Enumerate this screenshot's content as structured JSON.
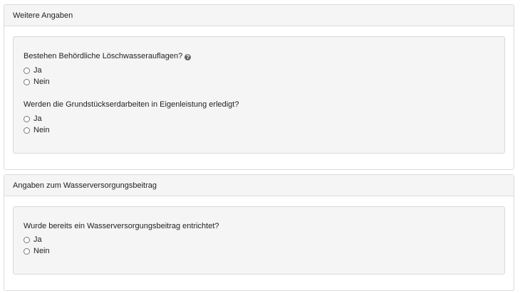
{
  "panels": [
    {
      "title": "Weitere Angaben",
      "questions": [
        {
          "label": "Bestehen Behördliche Löschwasserauflagen?",
          "help": "?",
          "options": [
            "Ja",
            "Nein"
          ]
        },
        {
          "label": "Werden die Grundstückserdarbeiten in Eigenleistung erledigt?",
          "options": [
            "Ja",
            "Nein"
          ]
        }
      ]
    },
    {
      "title": "Angaben zum Wasserversorgungsbeitrag",
      "questions": [
        {
          "label": "Wurde bereits ein Wasserversorgungsbeitrag entrichtet?",
          "options": [
            "Ja",
            "Nein"
          ]
        }
      ]
    }
  ]
}
